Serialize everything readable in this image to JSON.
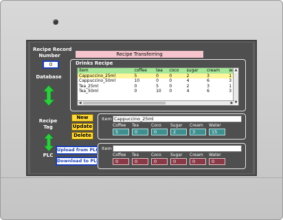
{
  "screen": {
    "title": "Recipe Transferring",
    "recipe_record_label": "Recipe Record\nNumber",
    "record_number": "0",
    "database_label": "Database",
    "recipe_tag_label": "Recipe\nTag",
    "plc_label": "PLC"
  },
  "drinks": {
    "title": "Drinks Recipe",
    "columns": [
      "item",
      "coffee",
      "tea",
      "coco",
      "sugar",
      "cream",
      "wa"
    ],
    "rows": [
      [
        "Cappuccino_25ml",
        "5",
        "0",
        "0",
        "2",
        "3",
        "1"
      ],
      [
        "Cappuccino_50ml",
        "10",
        "0",
        "0",
        "4",
        "6",
        "3"
      ],
      [
        "Tea_25ml",
        "0",
        "5",
        "0",
        "2",
        "3",
        "1"
      ],
      [
        "Tea_50ml",
        "0",
        "10",
        "0",
        "4",
        "6",
        "3"
      ]
    ]
  },
  "buttons": {
    "new": "New",
    "update": "Update",
    "delete": "Delete",
    "upload": "Upload from PLC",
    "download": "Download to PLC"
  },
  "tag_panel": {
    "item_label": "Item",
    "item_value": "Cappuccino_25ml",
    "fields": [
      {
        "label": "Coffee",
        "value": "5"
      },
      {
        "label": "Tea",
        "value": "0"
      },
      {
        "label": "Coco",
        "value": "0"
      },
      {
        "label": "Sugar",
        "value": "2"
      },
      {
        "label": "Cream",
        "value": "3"
      },
      {
        "label": "Water",
        "value": "15"
      }
    ]
  },
  "plc_panel": {
    "item_label": "Item",
    "item_value": "",
    "fields": [
      {
        "label": "Coffee",
        "value": "0"
      },
      {
        "label": "Tea",
        "value": "0"
      },
      {
        "label": "Coco",
        "value": "0"
      },
      {
        "label": "Sugar",
        "value": "0"
      },
      {
        "label": "Cream",
        "value": "0"
      },
      {
        "label": "Water",
        "value": "0"
      }
    ]
  },
  "colors": {
    "bezel": "#cfcfcf",
    "screen": "#4f4f4f",
    "accent_blue": "#1a3fb5",
    "button_yellow": "#ffd83a",
    "teal_value": "#3f8f8f",
    "maroon_value": "#8a3a46",
    "table_header": "#a6e79a",
    "selected_row": "#fff59a",
    "title_bar": "#f5c4cc"
  }
}
